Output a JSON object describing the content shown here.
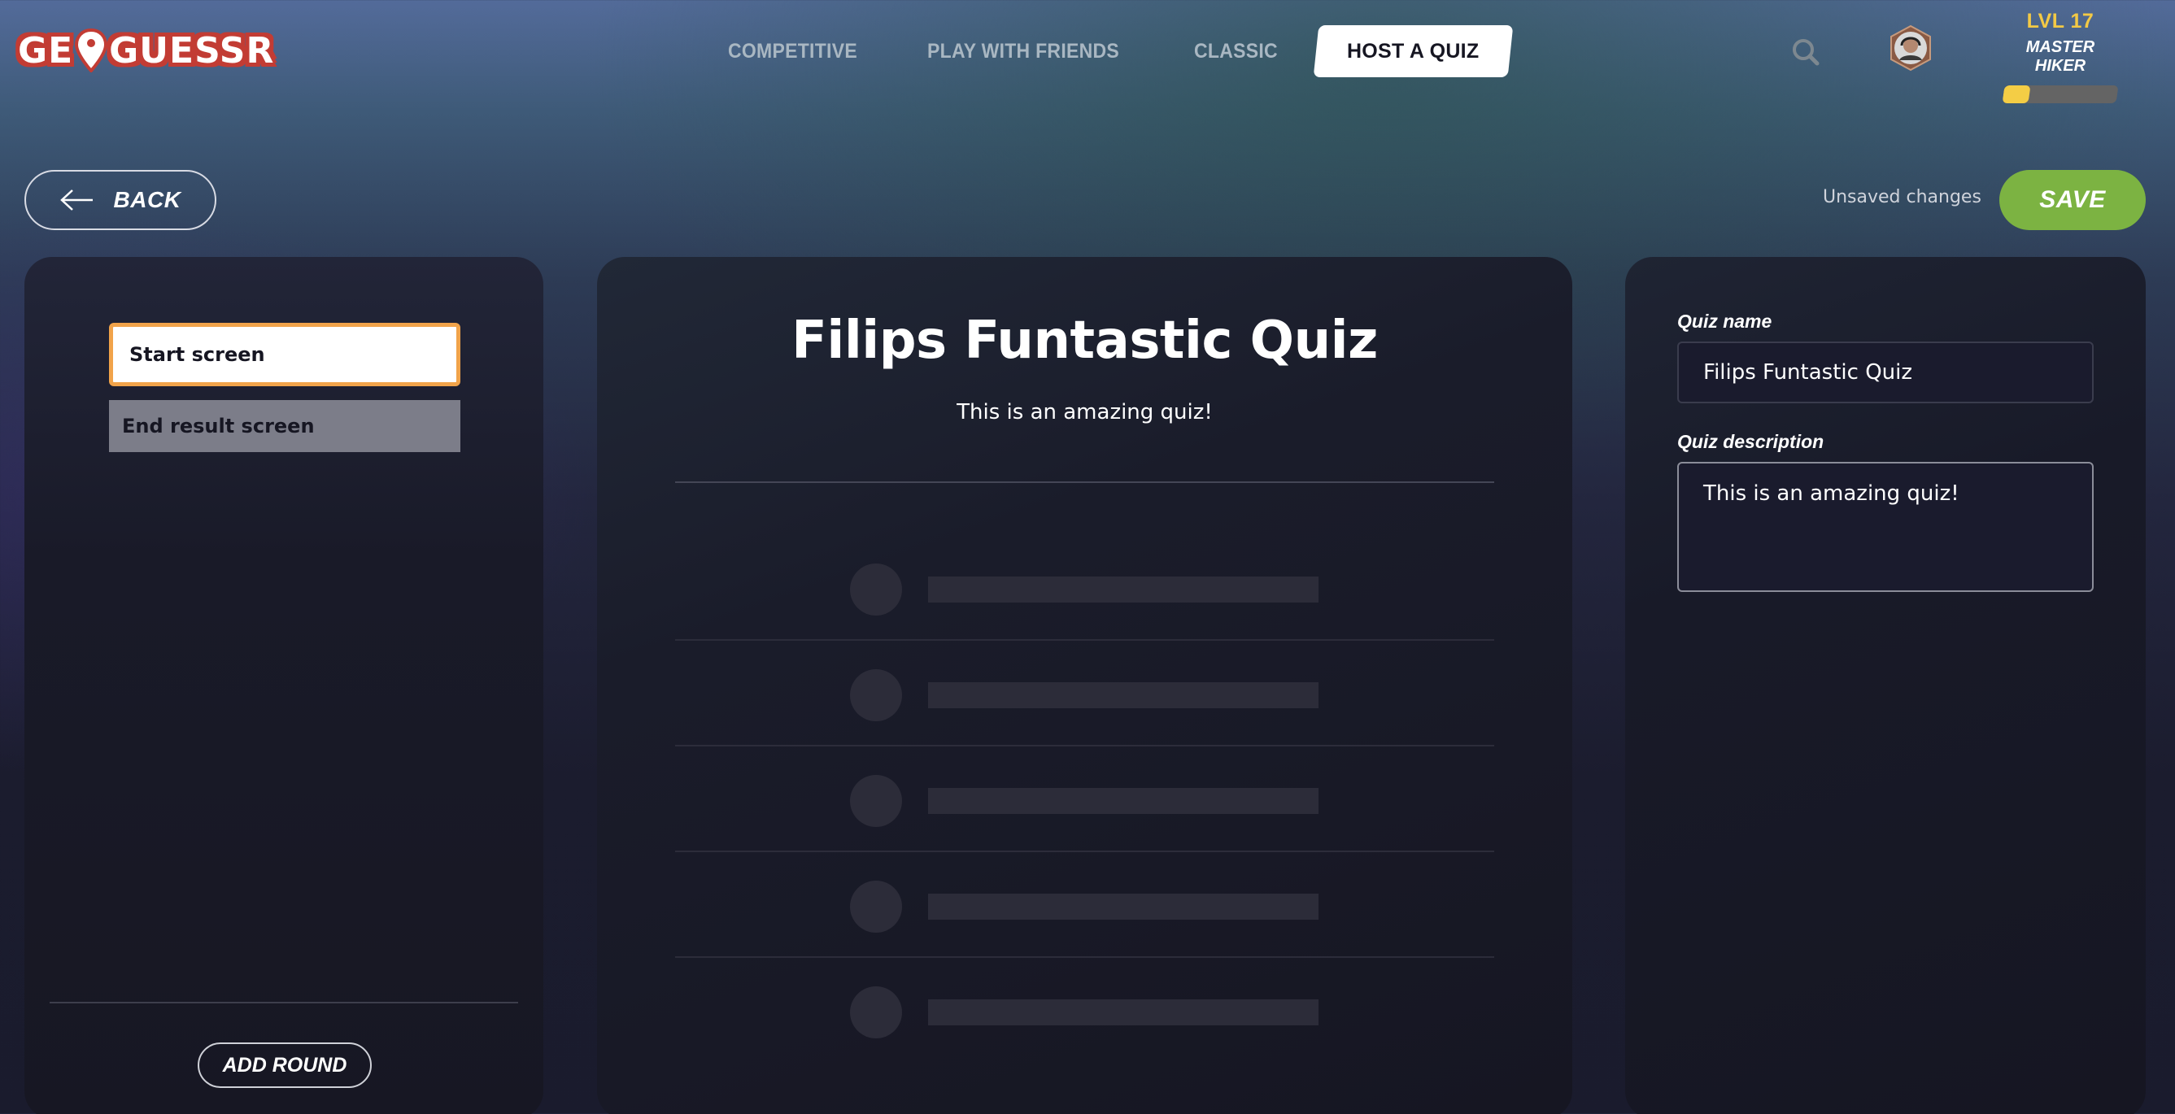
{
  "brand": {
    "logo_text_left": "GE",
    "logo_text_right": "GUESSR",
    "logo_color": "#c23c34"
  },
  "nav": {
    "items": [
      {
        "label": "COMPETITIVE",
        "active": false
      },
      {
        "label": "PLAY WITH FRIENDS",
        "active": false
      },
      {
        "label": "CLASSIC",
        "active": false
      },
      {
        "label": "HOST A QUIZ",
        "active": true
      }
    ]
  },
  "user": {
    "level_label": "LVL 17",
    "rank_title": "MASTER HIKER",
    "xp_progress_percent": 23,
    "level_color": "#f3c945"
  },
  "toolbar": {
    "back_label": "BACK",
    "status_text": "Unsaved changes",
    "save_label": "SAVE",
    "save_color": "#7cb342"
  },
  "screens_panel": {
    "items": [
      {
        "label": "Start screen",
        "selected": true
      },
      {
        "label": "End result screen",
        "selected": false
      }
    ],
    "add_round_label": "ADD ROUND",
    "selected_border_color": "#f1a34a"
  },
  "preview": {
    "title": "Filips Funtastic Quiz",
    "description": "This is an amazing quiz!",
    "placeholder_rows": 5
  },
  "settings": {
    "quiz_name_label": "Quiz name",
    "quiz_name_value": "Filips Funtastic Quiz",
    "quiz_description_label": "Quiz description",
    "quiz_description_value": "This is an amazing quiz!"
  }
}
